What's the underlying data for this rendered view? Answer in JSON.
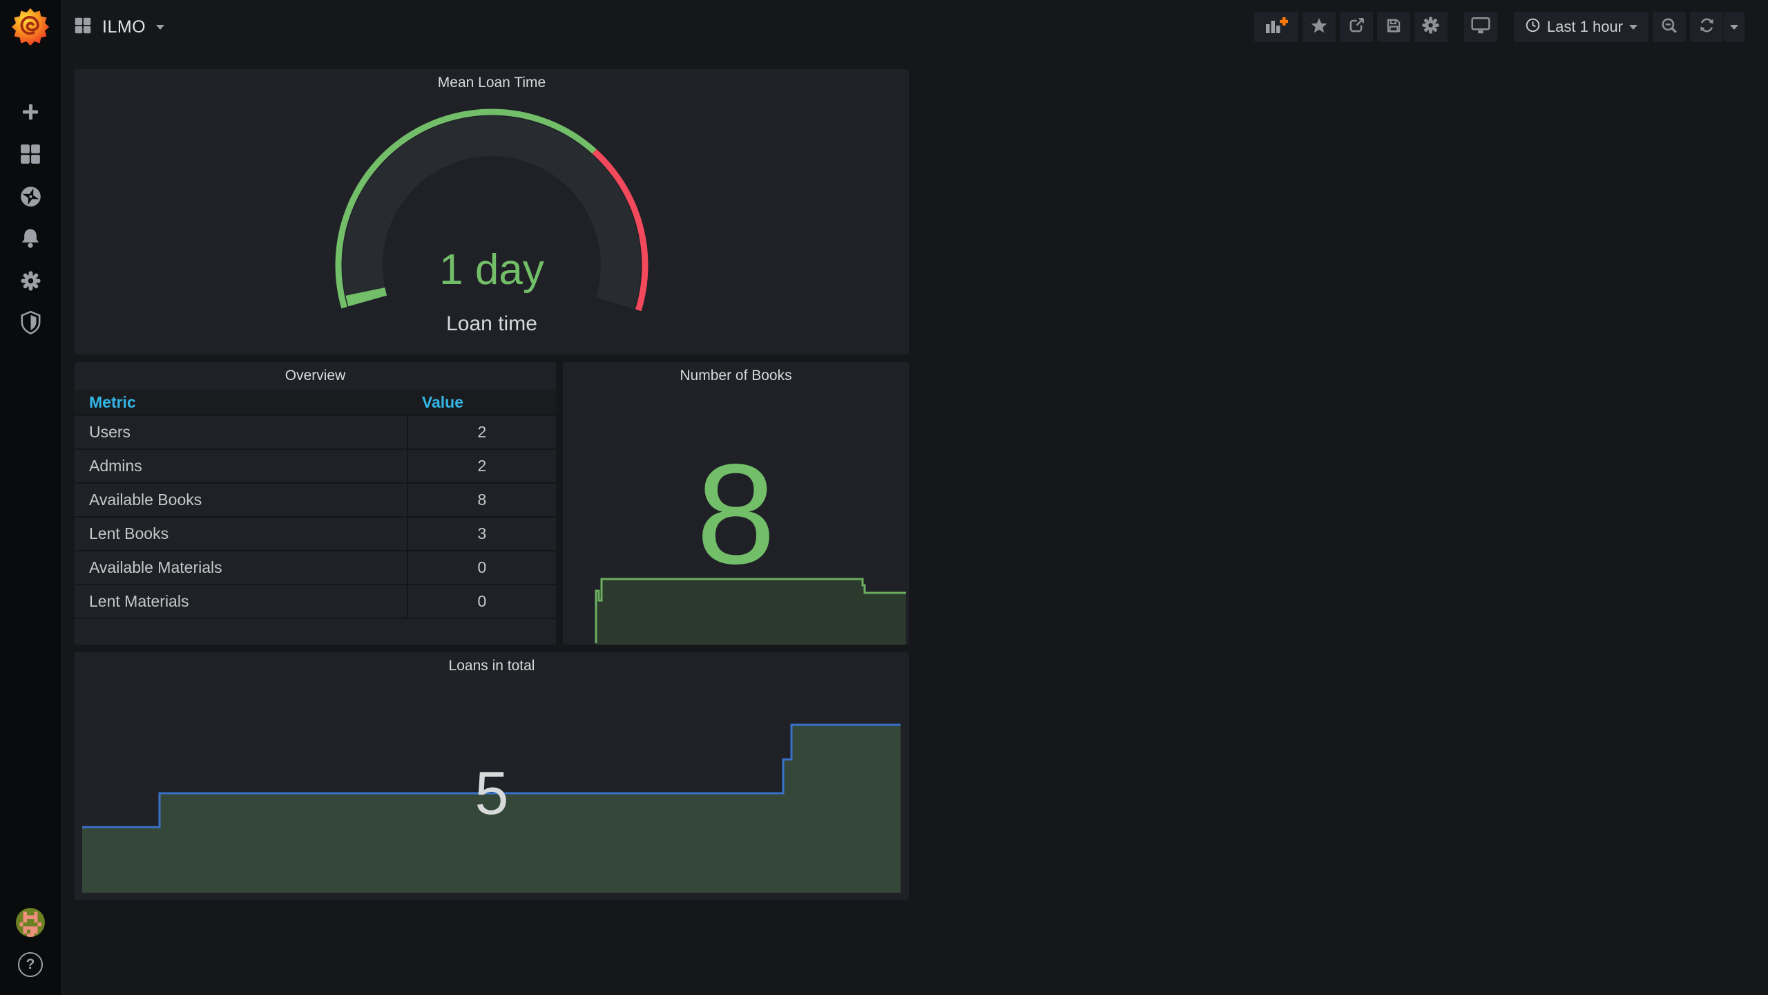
{
  "app": {
    "name": "Grafana"
  },
  "navbar": {
    "title": "ILMO",
    "title_icon": "squares-icon",
    "time_range_label": "Last 1 hour",
    "buttons": [
      "add-panel",
      "mark-as-favorite",
      "share-dashboard",
      "save-dashboard",
      "dashboard-settings",
      "cycle-view-mode",
      "time-range-picker",
      "zoom-out-time-range",
      "refresh-dashboard",
      "refresh-interval-picker"
    ]
  },
  "sidebar": {
    "items": [
      {
        "label": "create",
        "icon": "plus-icon"
      },
      {
        "label": "dashboards",
        "icon": "squares-icon"
      },
      {
        "label": "explore",
        "icon": "compass-icon"
      },
      {
        "label": "alerting",
        "icon": "bell-icon"
      },
      {
        "label": "configuration",
        "icon": "gear-icon"
      },
      {
        "label": "server-admin",
        "icon": "shield-icon"
      }
    ],
    "help_glyph": "?",
    "avatar_pixels": [
      "........",
      "..#..#..",
      "..####..",
      "..#..#..",
      ".#....#.",
      "..####..",
      "..#.##..",
      "...##..."
    ],
    "avatar_bg": "#6B8122",
    "avatar_fg": "#EF8F7D"
  },
  "colors": {
    "green": "#73BF69",
    "red": "#F2495C",
    "table_header_blue": "#33B5E5",
    "stat_gray": "#D8D9DA",
    "books_fill": "#2C3A2E",
    "books_line": "#6CAE60",
    "loans_fill": "#344739",
    "loans_line": "#3871C9",
    "gauge_track": "#282B30",
    "accent_orange": "#FF780A"
  },
  "panels": {
    "gauge": {
      "title": "Mean Loan Time",
      "chart_data": {
        "type": "gauge",
        "value_text": "1 day",
        "label": "Loan time",
        "value_fraction": 0.02,
        "threshold_fraction": 0.695,
        "start_angle": 196,
        "end_angle": -17,
        "threshold_colors": [
          "#73BF69",
          "#F2495C"
        ]
      }
    },
    "overview": {
      "title": "Overview",
      "chart_data": {
        "type": "table",
        "columns": [
          "Metric",
          "Value"
        ],
        "rows": [
          [
            "Users",
            "2"
          ],
          [
            "Admins",
            "2"
          ],
          [
            "Available Books",
            "8"
          ],
          [
            "Lent Books",
            "3"
          ],
          [
            "Available Materials",
            "0"
          ],
          [
            "Lent Materials",
            "0"
          ]
        ]
      }
    },
    "books": {
      "title": "Number of Books",
      "chart_data": {
        "type": "stat",
        "value": "8",
        "sparkline_points": [
          [
            48,
            407
          ],
          [
            48,
            331
          ],
          [
            52,
            331
          ],
          [
            52,
            345
          ],
          [
            56,
            345
          ],
          [
            56,
            314
          ],
          [
            430,
            314
          ],
          [
            434,
            314
          ],
          [
            434,
            323
          ],
          [
            437,
            323
          ],
          [
            437,
            334
          ],
          [
            497,
            334
          ]
        ],
        "sparkline_box": [
          501,
          409
        ]
      }
    },
    "loans": {
      "title": "Loans in total",
      "chart_data": {
        "type": "stat",
        "value": "5",
        "line_points": [
          [
            11,
            253
          ],
          [
            123,
            253
          ],
          [
            123,
            204
          ],
          [
            1026,
            204
          ],
          [
            1026,
            155
          ],
          [
            1038,
            155
          ],
          [
            1038,
            105
          ],
          [
            1196,
            105
          ]
        ],
        "fill_bottom": 348,
        "line_box": [
          1208,
          358
        ]
      }
    }
  }
}
